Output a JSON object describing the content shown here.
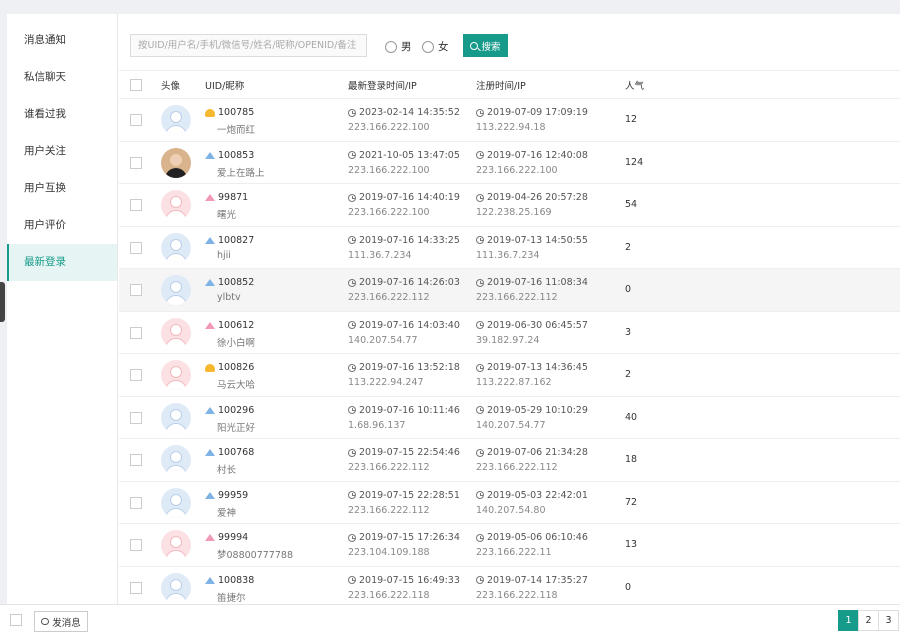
{
  "sidebar": {
    "items": [
      {
        "label": "消息通知"
      },
      {
        "label": "私信聊天"
      },
      {
        "label": "谁看过我"
      },
      {
        "label": "用户关注"
      },
      {
        "label": "用户互换"
      },
      {
        "label": "用户评价"
      },
      {
        "label": "最新登录",
        "active": true
      }
    ]
  },
  "toolbar": {
    "search_placeholder": "按UID/用户名/手机/微信号/姓名/昵称/OPENID/备注",
    "radio_male": "男",
    "radio_female": "女",
    "search_button": "搜索"
  },
  "table": {
    "headers": {
      "avatar": "头像",
      "uid": "UID/昵称",
      "last_login": "最新登录时间/IP",
      "register": "注册时间/IP",
      "popularity": "人气"
    },
    "rows": [
      {
        "uid": "100785",
        "nick": "一炮而红",
        "badge": "gold",
        "avatar": "m",
        "login_time": "2023-02-14 14:35:52",
        "login_ip": "223.166.222.100",
        "reg_time": "2019-07-09 17:09:19",
        "reg_ip": "113.222.94.18",
        "popularity": "12"
      },
      {
        "uid": "100853",
        "nick": "爱上在路上",
        "badge": "blue",
        "avatar": "photo",
        "login_time": "2021-10-05 13:47:05",
        "login_ip": "223.166.222.100",
        "reg_time": "2019-07-16 12:40:08",
        "reg_ip": "223.166.222.100",
        "popularity": "124"
      },
      {
        "uid": "99871",
        "nick": "曙光",
        "badge": "pink",
        "avatar": "f",
        "login_time": "2019-07-16 14:40:19",
        "login_ip": "223.166.222.100",
        "reg_time": "2019-04-26 20:57:28",
        "reg_ip": "122.238.25.169",
        "popularity": "54"
      },
      {
        "uid": "100827",
        "nick": "hjii",
        "badge": "blue",
        "avatar": "m",
        "login_time": "2019-07-16 14:33:25",
        "login_ip": "111.36.7.234",
        "reg_time": "2019-07-13 14:50:55",
        "reg_ip": "111.36.7.234",
        "popularity": "2"
      },
      {
        "uid": "100852",
        "nick": "ylbtv",
        "badge": "blue",
        "avatar": "m",
        "login_time": "2019-07-16 14:26:03",
        "login_ip": "223.166.222.112",
        "reg_time": "2019-07-16 11:08:34",
        "reg_ip": "223.166.222.112",
        "popularity": "0",
        "highlight": true
      },
      {
        "uid": "100612",
        "nick": "徐小白啊",
        "badge": "pink",
        "avatar": "f",
        "login_time": "2019-07-16 14:03:40",
        "login_ip": "140.207.54.77",
        "reg_time": "2019-06-30 06:45:57",
        "reg_ip": "39.182.97.24",
        "popularity": "3"
      },
      {
        "uid": "100826",
        "nick": "马云大哈",
        "badge": "gold",
        "avatar": "f",
        "login_time": "2019-07-16 13:52:18",
        "login_ip": "113.222.94.247",
        "reg_time": "2019-07-13 14:36:45",
        "reg_ip": "113.222.87.162",
        "popularity": "2"
      },
      {
        "uid": "100296",
        "nick": "阳光正好",
        "badge": "blue",
        "avatar": "m",
        "login_time": "2019-07-16 10:11:46",
        "login_ip": "1.68.96.137",
        "reg_time": "2019-05-29 10:10:29",
        "reg_ip": "140.207.54.77",
        "popularity": "40"
      },
      {
        "uid": "100768",
        "nick": "村长",
        "badge": "blue",
        "avatar": "m",
        "login_time": "2019-07-15 22:54:46",
        "login_ip": "223.166.222.112",
        "reg_time": "2019-07-06 21:34:28",
        "reg_ip": "223.166.222.112",
        "popularity": "18"
      },
      {
        "uid": "99959",
        "nick": "爱神",
        "badge": "blue",
        "avatar": "m",
        "login_time": "2019-07-15 22:28:51",
        "login_ip": "223.166.222.112",
        "reg_time": "2019-05-03 22:42:01",
        "reg_ip": "140.207.54.80",
        "popularity": "72"
      },
      {
        "uid": "99994",
        "nick": "梦08800777788",
        "badge": "pink",
        "avatar": "f",
        "login_time": "2019-07-15 17:26:34",
        "login_ip": "223.104.109.188",
        "reg_time": "2019-05-06 06:10:46",
        "reg_ip": "223.166.222.11",
        "popularity": "13"
      },
      {
        "uid": "100838",
        "nick": "笛捷尔",
        "badge": "blue",
        "avatar": "m",
        "login_time": "2019-07-15 16:49:33",
        "login_ip": "223.166.222.118",
        "reg_time": "2019-07-14 17:35:27",
        "reg_ip": "223.166.222.118",
        "popularity": "0"
      }
    ]
  },
  "footer": {
    "message_button": "发消息",
    "pages": [
      "1",
      "2",
      "3"
    ],
    "current_page": "1"
  },
  "colors": {
    "accent": "#169a8a"
  }
}
